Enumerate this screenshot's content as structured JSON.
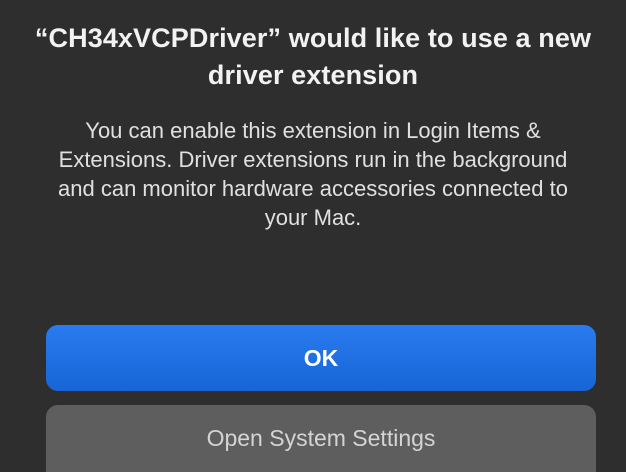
{
  "dialog": {
    "title": "“CH34xVCPDriver” would like to use a new driver extension",
    "message": "You can enable this extension in Login Items & Extensions. Driver extensions run in the background and can monitor hardware accessories connected to your Mac.",
    "ok_label": "OK",
    "settings_label": "Open System Settings"
  },
  "colors": {
    "background": "#2e2e2e",
    "primary_button": "#1f6fe0",
    "secondary_button": "#5e5e5e"
  }
}
